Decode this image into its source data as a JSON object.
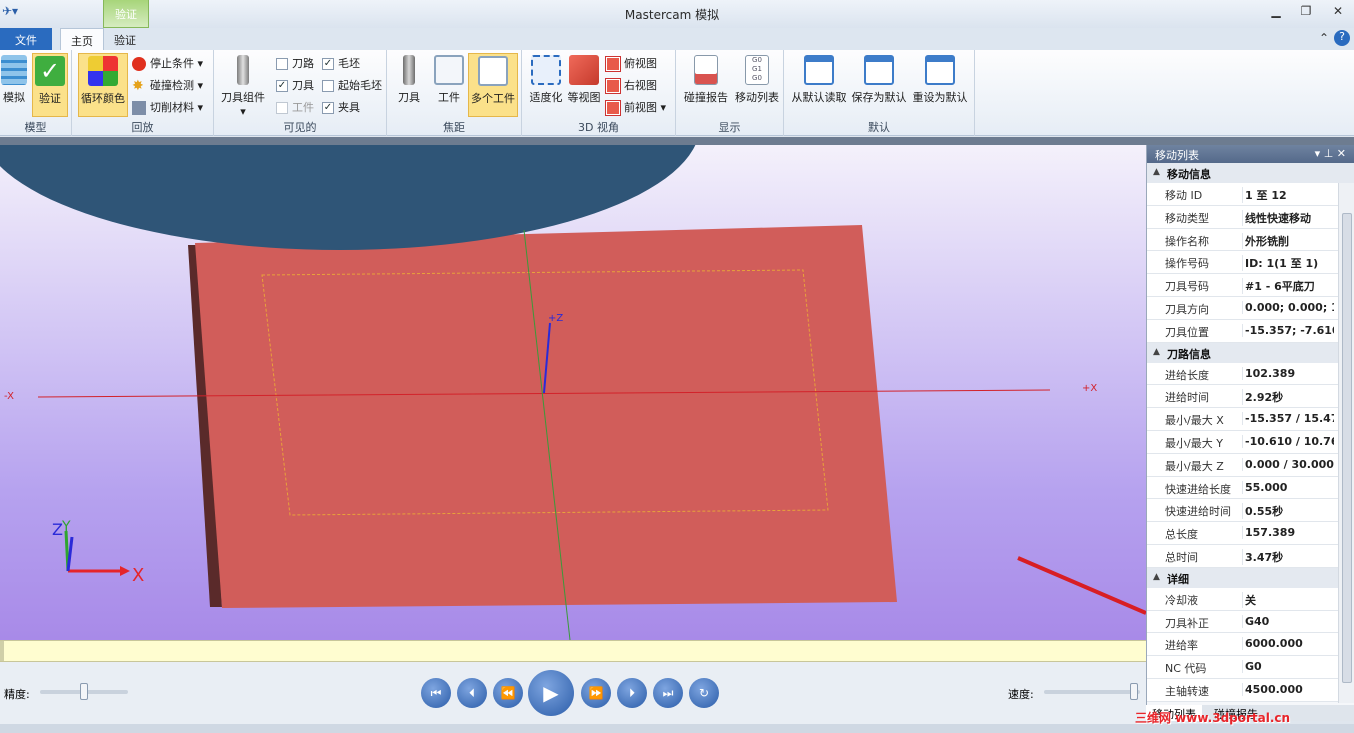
{
  "window": {
    "title": "Mastercam 模拟",
    "context_tab": "验证"
  },
  "tabs": {
    "file": "文件",
    "home": "主页",
    "verify": "验证"
  },
  "ribbon": {
    "model": {
      "label": "模型",
      "simulate": "模拟",
      "verify": "验证"
    },
    "playback": {
      "label": "回放",
      "cycle_color": "循环颜色",
      "stop_condition": "停止条件",
      "collision_check": "碰撞检测",
      "cut_material": "切削材料"
    },
    "visible": {
      "label": "可见的",
      "tool_assembly": "刀具组件",
      "toolpath": "刀路",
      "tool": "刀具",
      "workpiece": "工件",
      "stock": "毛坯",
      "initial_stock": "起始毛坯",
      "fixture": "夹具",
      "checks": {
        "toolpath": false,
        "tool": true,
        "workpiece": false,
        "stock": true,
        "initial_stock": false,
        "fixture": true
      }
    },
    "focus": {
      "label": "焦距",
      "tool": "刀具",
      "workpiece": "工件",
      "multi_workpiece": "多个工件"
    },
    "view3d": {
      "label": "3D 视角",
      "fit": "适度化",
      "iso": "等视图",
      "top": "俯视图",
      "right": "右视图",
      "front": "前视图"
    },
    "display": {
      "label": "显示",
      "collision_report": "碰撞报告",
      "move_list": "移动列表"
    },
    "defaults": {
      "label": "默认",
      "load_default": "从默认读取",
      "save_default": "保存为默认",
      "reset_default": "重设为默认"
    }
  },
  "viewport": {
    "axis_neg_x": "-X",
    "axis_pos_x": "+X",
    "axis_pos_z": "+Z",
    "triad_x": "X",
    "triad_y": "Y",
    "triad_z": "Z"
  },
  "playbar": {
    "precision_label": "精度:",
    "speed_label": "速度:"
  },
  "panel": {
    "title": "移动列表",
    "move_info": {
      "title": "移动信息",
      "rows": [
        {
          "k": "移动 ID",
          "v": "1 至 12"
        },
        {
          "k": "移动类型",
          "v": "线性快速移动"
        },
        {
          "k": "操作名称",
          "v": "外形铣削"
        },
        {
          "k": "操作号码",
          "v": "ID: 1(1 至 1)"
        },
        {
          "k": "刀具号码",
          "v": "#1 - 6平底刀"
        },
        {
          "k": "刀具方向",
          "v": "0.000; 0.000; 1."
        },
        {
          "k": "刀具位置",
          "v": "-15.357; -7.610"
        }
      ]
    },
    "path_info": {
      "title": "刀路信息",
      "rows": [
        {
          "k": "进给长度",
          "v": "102.389"
        },
        {
          "k": "进给时间",
          "v": "2.92秒"
        },
        {
          "k": "最小/最大 X",
          "v": "-15.357 / 15.47"
        },
        {
          "k": "最小/最大 Y",
          "v": "-10.610 / 10.76"
        },
        {
          "k": "最小/最大 Z",
          "v": "0.000 / 30.000"
        },
        {
          "k": "快速进给长度",
          "v": "55.000"
        },
        {
          "k": "快速进给时间",
          "v": "0.55秒"
        },
        {
          "k": "总长度",
          "v": "157.389"
        },
        {
          "k": "总时间",
          "v": "3.47秒"
        }
      ]
    },
    "details": {
      "title": "详细",
      "rows": [
        {
          "k": "冷却液",
          "v": "关"
        },
        {
          "k": "刀具补正",
          "v": "G40"
        },
        {
          "k": "进给率",
          "v": "6000.000"
        },
        {
          "k": "NC 代码",
          "v": "G0"
        },
        {
          "k": "主轴转速",
          "v": "4500.000"
        }
      ]
    },
    "bottom_tabs": [
      "移动列表",
      "碰撞报告"
    ]
  },
  "watermark": "三维网 www.3dportal.cn",
  "colors": {
    "stock": "#d15d5a",
    "tool": "#2f5577",
    "accent": "#2a6bbf"
  }
}
